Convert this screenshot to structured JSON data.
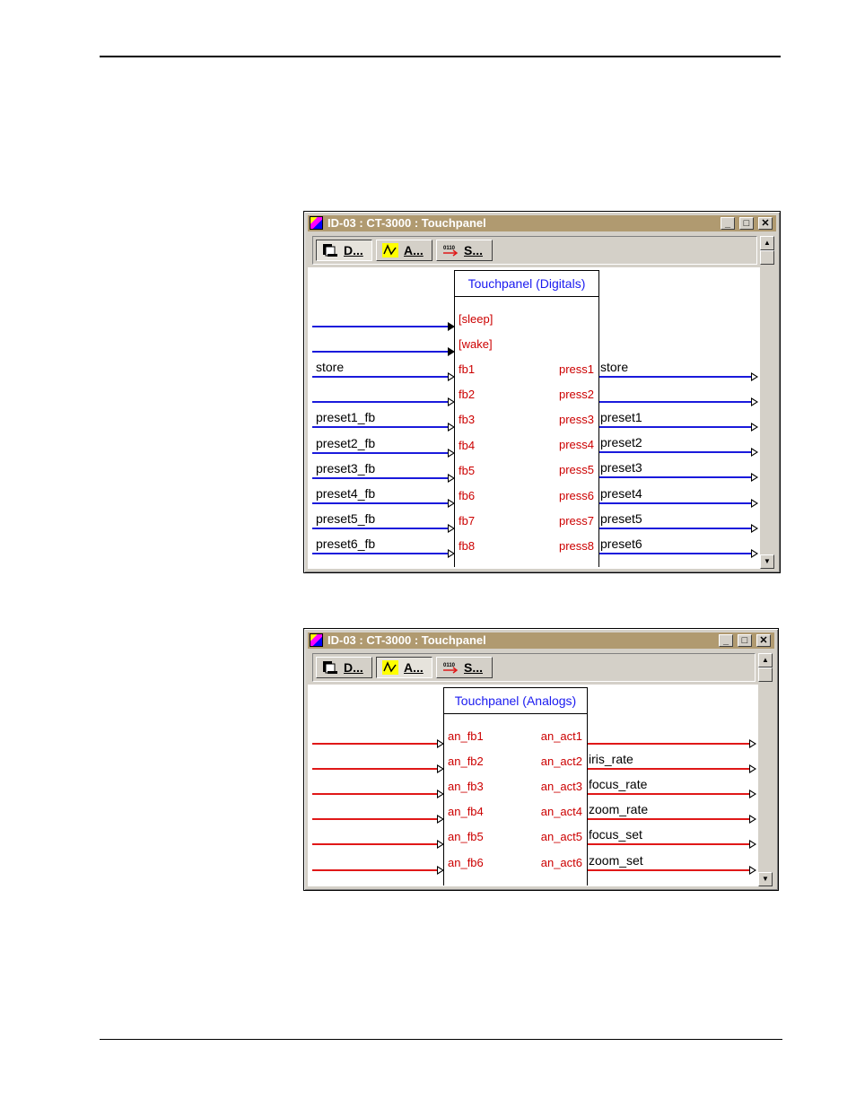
{
  "digitals_window": {
    "title": "ID-03 : CT-3000 : Touchpanel",
    "toolbar": [
      {
        "label": "D...",
        "icon": "digital-icon",
        "pressed": true
      },
      {
        "label": "A...",
        "icon": "analog-icon",
        "pressed": false
      },
      {
        "label": "S...",
        "icon": "serial-icon",
        "pressed": false
      }
    ],
    "symbol_title": "Touchpanel (Digitals)",
    "inputs": [
      {
        "pin": "[sleep]",
        "signal": ""
      },
      {
        "pin": "[wake]",
        "signal": ""
      },
      {
        "pin": "fb1",
        "signal": "store"
      },
      {
        "pin": "fb2",
        "signal": ""
      },
      {
        "pin": "fb3",
        "signal": "preset1_fb"
      },
      {
        "pin": "fb4",
        "signal": "preset2_fb"
      },
      {
        "pin": "fb5",
        "signal": "preset3_fb"
      },
      {
        "pin": "fb6",
        "signal": "preset4_fb"
      },
      {
        "pin": "fb7",
        "signal": "preset5_fb"
      },
      {
        "pin": "fb8",
        "signal": "preset6_fb"
      }
    ],
    "outputs": [
      {
        "pin": "press1",
        "signal": "store"
      },
      {
        "pin": "press2",
        "signal": ""
      },
      {
        "pin": "press3",
        "signal": "preset1"
      },
      {
        "pin": "press4",
        "signal": "preset2"
      },
      {
        "pin": "press5",
        "signal": "preset3"
      },
      {
        "pin": "press6",
        "signal": "preset4"
      },
      {
        "pin": "press7",
        "signal": "preset5"
      },
      {
        "pin": "press8",
        "signal": "preset6"
      }
    ],
    "wire_color": "#1a1adc"
  },
  "analogs_window": {
    "title": "ID-03 : CT-3000 : Touchpanel",
    "toolbar": [
      {
        "label": "D...",
        "icon": "digital-icon",
        "pressed": false
      },
      {
        "label": "A...",
        "icon": "analog-icon",
        "pressed": true
      },
      {
        "label": "S...",
        "icon": "serial-icon",
        "pressed": false
      }
    ],
    "symbol_title": "Touchpanel (Analogs)",
    "inputs": [
      {
        "pin": "an_fb1",
        "signal": ""
      },
      {
        "pin": "an_fb2",
        "signal": ""
      },
      {
        "pin": "an_fb3",
        "signal": ""
      },
      {
        "pin": "an_fb4",
        "signal": ""
      },
      {
        "pin": "an_fb5",
        "signal": ""
      },
      {
        "pin": "an_fb6",
        "signal": ""
      }
    ],
    "outputs": [
      {
        "pin": "an_act1",
        "signal": ""
      },
      {
        "pin": "an_act2",
        "signal": "iris_rate"
      },
      {
        "pin": "an_act3",
        "signal": "focus_rate"
      },
      {
        "pin": "an_act4",
        "signal": "zoom_rate"
      },
      {
        "pin": "an_act5",
        "signal": "focus_set"
      },
      {
        "pin": "an_act6",
        "signal": "zoom_set"
      }
    ],
    "wire_color": "#e01818"
  }
}
